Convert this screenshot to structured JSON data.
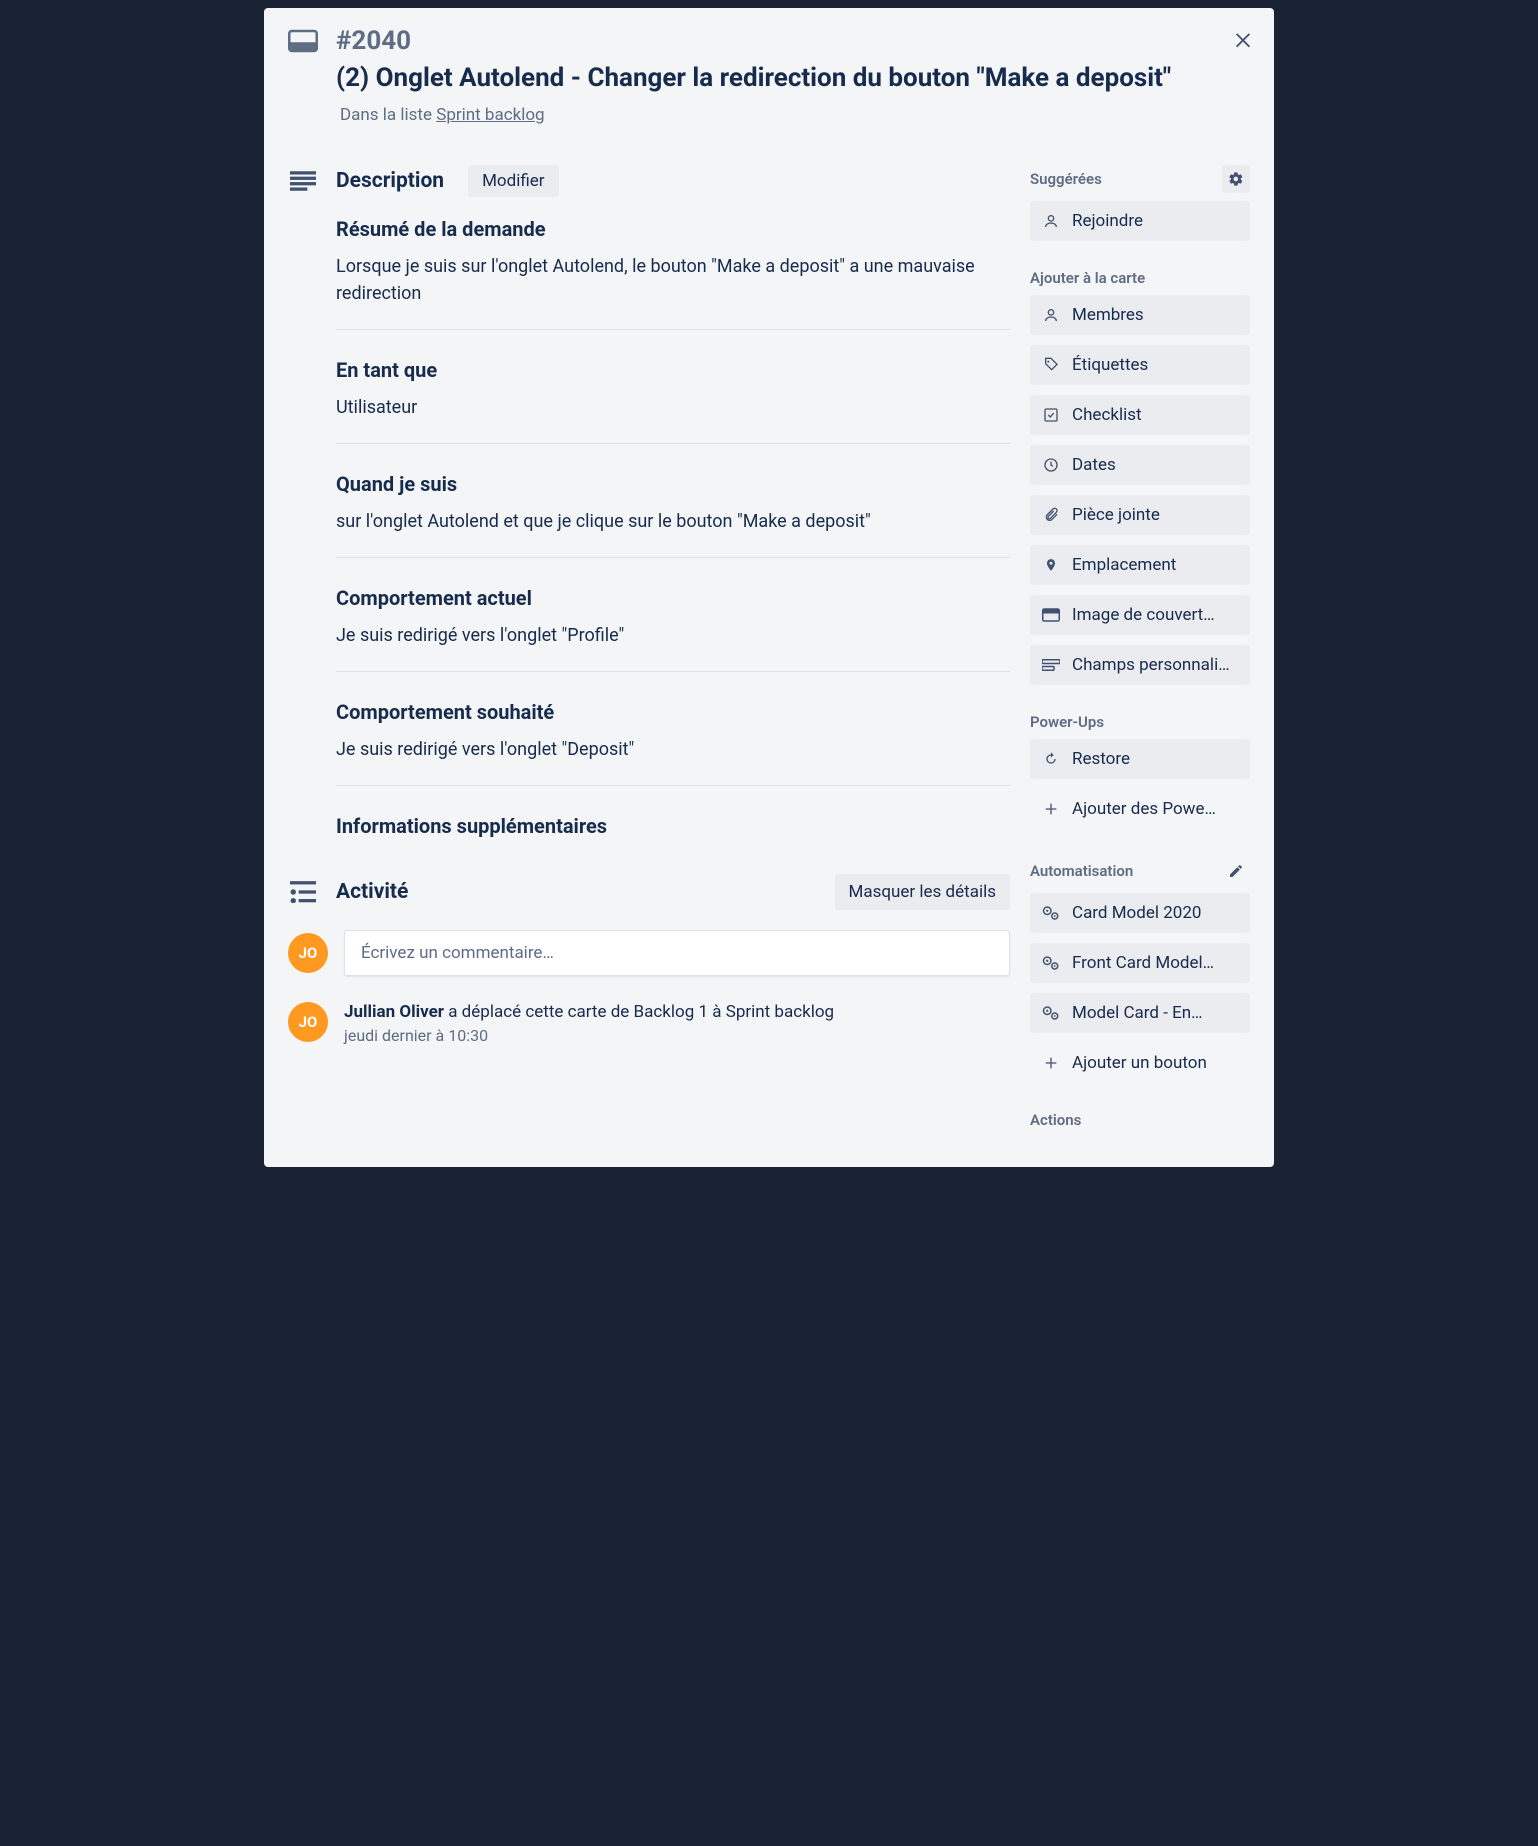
{
  "card": {
    "number": "#2040",
    "title": "(2) Onglet Autolend - Changer la redirection du bouton \"Make a deposit\"",
    "inListPrefix": "Dans la liste ",
    "listName": "Sprint backlog"
  },
  "description": {
    "sectionTitle": "Description",
    "modifyLabel": "Modifier",
    "blocks": [
      {
        "heading": "Résumé de la demande",
        "text": "Lorsque je suis sur l'onglet Autolend, le bouton \"Make a deposit\" a une mauvaise redirection"
      },
      {
        "heading": "En tant que",
        "text": "Utilisateur"
      },
      {
        "heading": "Quand je suis",
        "text": "sur l'onglet Autolend et que je clique sur le bouton \"Make a deposit\""
      },
      {
        "heading": "Comportement actuel",
        "text": "Je suis redirigé vers l'onglet \"Profile\""
      },
      {
        "heading": "Comportement souhaité",
        "text": "Je suis redirigé vers l'onglet \"Deposit\""
      },
      {
        "heading": "Informations supplémentaires",
        "text": ""
      }
    ]
  },
  "activity": {
    "sectionTitle": "Activité",
    "hideDetails": "Masquer les détails",
    "commentPlaceholder": "Écrivez un commentaire…",
    "userInitials": "JO",
    "items": [
      {
        "user": "Jullian Oliver",
        "action": " a déplacé cette carte de Backlog 1 à Sprint backlog",
        "date": "jeudi dernier à 10:30"
      }
    ]
  },
  "sidebar": {
    "suggested": {
      "heading": "Suggérées",
      "join": "Rejoindre"
    },
    "addToCard": {
      "heading": "Ajouter à la carte",
      "members": "Membres",
      "labels": "Étiquettes",
      "checklist": "Checklist",
      "dates": "Dates",
      "attachment": "Pièce jointe",
      "location": "Emplacement",
      "cover": "Image de couvert…",
      "customFields": "Champs personnali…"
    },
    "powerUps": {
      "heading": "Power-Ups",
      "restore": "Restore",
      "add": "Ajouter des Powe…"
    },
    "automation": {
      "heading": "Automatisation",
      "items": [
        "Card Model 2020",
        "Front Card Model…",
        "Model Card - En…"
      ],
      "addButton": "Ajouter un bouton"
    },
    "actions": {
      "heading": "Actions"
    }
  }
}
